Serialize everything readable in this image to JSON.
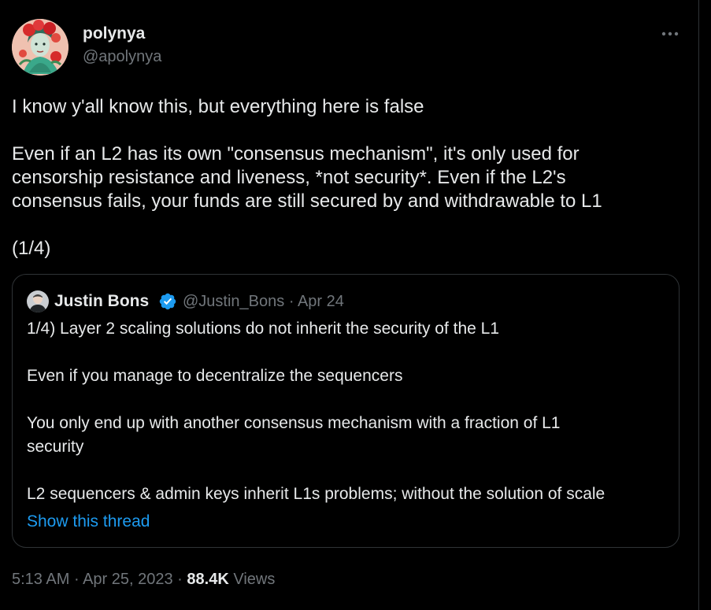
{
  "tweet": {
    "author": {
      "display_name": "polynya",
      "handle": "@apolynya",
      "avatar_icon": "illustrated-avatar-icon"
    },
    "more_icon": "more-options-icon",
    "text_lines": [
      "I know y'all know this, but everything here is false",
      "",
      "Even if an L2 has its own \"consensus mechanism\", it's only used for",
      "censorship resistance and liveness, *not security*. Even if the L2's",
      "consensus fails, your funds are still secured by and withdrawable to L1",
      "",
      "(1/4)"
    ],
    "quoted": {
      "display_name": "Justin Bons",
      "verified_icon": "verified-badge-icon",
      "handle": "@Justin_Bons",
      "separator": "·",
      "date": "Apr 24",
      "text_lines": [
        "1/4) Layer 2 scaling solutions do not inherit the security of the L1",
        "",
        "Even if you manage to decentralize the sequencers",
        "",
        "You only end up with another consensus mechanism with a fraction of L1",
        "security",
        "",
        "L2 sequencers & admin keys inherit L1s problems; without the solution of scale"
      ],
      "show_thread_label": "Show this thread"
    },
    "timestamp": "5:13 AM",
    "separator": "·",
    "date": "Apr 25, 2023",
    "views_count": "88.4K",
    "views_label": "Views"
  },
  "colors": {
    "background": "#000000",
    "text_primary": "#e7e9ea",
    "text_secondary": "#71767b",
    "link": "#1d9bf0",
    "border": "#2f3336",
    "verified": "#1d9bf0"
  }
}
